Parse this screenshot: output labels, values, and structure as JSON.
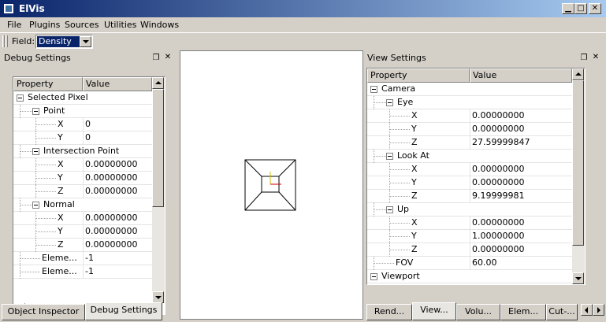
{
  "window": {
    "title": "ElVis"
  },
  "menu": [
    "File",
    "Plugins",
    "Sources",
    "Utilities",
    "Windows"
  ],
  "toolbar": {
    "field_label": "Field:",
    "field_value": "Density"
  },
  "debug_panel": {
    "title": "Debug Settings",
    "columns": [
      "Property",
      "Value"
    ],
    "rows": [
      {
        "label": "Selected Pixel",
        "value": "",
        "depth": 0,
        "exp": true
      },
      {
        "label": "Point",
        "value": "",
        "depth": 1,
        "exp": true
      },
      {
        "label": "X",
        "value": "0",
        "depth": 2,
        "exp": false
      },
      {
        "label": "Y",
        "value": "0",
        "depth": 2,
        "exp": false
      },
      {
        "label": "Intersection Point",
        "value": "",
        "depth": 1,
        "exp": true
      },
      {
        "label": "X",
        "value": "0.00000000",
        "depth": 2,
        "exp": false
      },
      {
        "label": "Y",
        "value": "0.00000000",
        "depth": 2,
        "exp": false
      },
      {
        "label": "Z",
        "value": "0.00000000",
        "depth": 2,
        "exp": false
      },
      {
        "label": "Normal",
        "value": "",
        "depth": 1,
        "exp": true
      },
      {
        "label": "X",
        "value": "0.00000000",
        "depth": 2,
        "exp": false
      },
      {
        "label": "Y",
        "value": "0.00000000",
        "depth": 2,
        "exp": false
      },
      {
        "label": "Z",
        "value": "0.00000000",
        "depth": 2,
        "exp": false
      },
      {
        "label": "Eleme...",
        "value": "-1",
        "depth": 1,
        "exp": false
      },
      {
        "label": "Eleme...",
        "value": "-1",
        "depth": 1,
        "exp": false
      }
    ],
    "tabs": [
      "Object Inspector",
      "Debug Settings"
    ],
    "active_tab": 1
  },
  "view_panel": {
    "title": "View Settings",
    "columns": [
      "Property",
      "Value"
    ],
    "rows": [
      {
        "label": "Camera",
        "value": "",
        "depth": 0,
        "exp": true
      },
      {
        "label": "Eye",
        "value": "",
        "depth": 1,
        "exp": true
      },
      {
        "label": "X",
        "value": "0.00000000",
        "depth": 2,
        "exp": false
      },
      {
        "label": "Y",
        "value": "0.00000000",
        "depth": 2,
        "exp": false
      },
      {
        "label": "Z",
        "value": "27.59999847",
        "depth": 2,
        "exp": false
      },
      {
        "label": "Look At",
        "value": "",
        "depth": 1,
        "exp": true
      },
      {
        "label": "X",
        "value": "0.00000000",
        "depth": 2,
        "exp": false
      },
      {
        "label": "Y",
        "value": "0.00000000",
        "depth": 2,
        "exp": false
      },
      {
        "label": "Z",
        "value": "9.19999981",
        "depth": 2,
        "exp": false
      },
      {
        "label": "Up",
        "value": "",
        "depth": 1,
        "exp": true
      },
      {
        "label": "X",
        "value": "0.00000000",
        "depth": 2,
        "exp": false
      },
      {
        "label": "Y",
        "value": "1.00000000",
        "depth": 2,
        "exp": false
      },
      {
        "label": "Z",
        "value": "0.00000000",
        "depth": 2,
        "exp": false
      },
      {
        "label": "FOV",
        "value": "60.00",
        "depth": 1,
        "exp": false
      },
      {
        "label": "Viewport",
        "value": "",
        "depth": 0,
        "exp": true
      }
    ],
    "tabs": [
      "Rend...",
      "View...",
      "Volu...",
      "Elem...",
      "Cut-..."
    ],
    "active_tab": 1
  },
  "colors": {
    "titlebar_start": "#0a246a",
    "titlebar_end": "#a6caf0",
    "selection": "#0a246a",
    "axis_x": "#cc0000",
    "axis_y": "#d4c000"
  }
}
